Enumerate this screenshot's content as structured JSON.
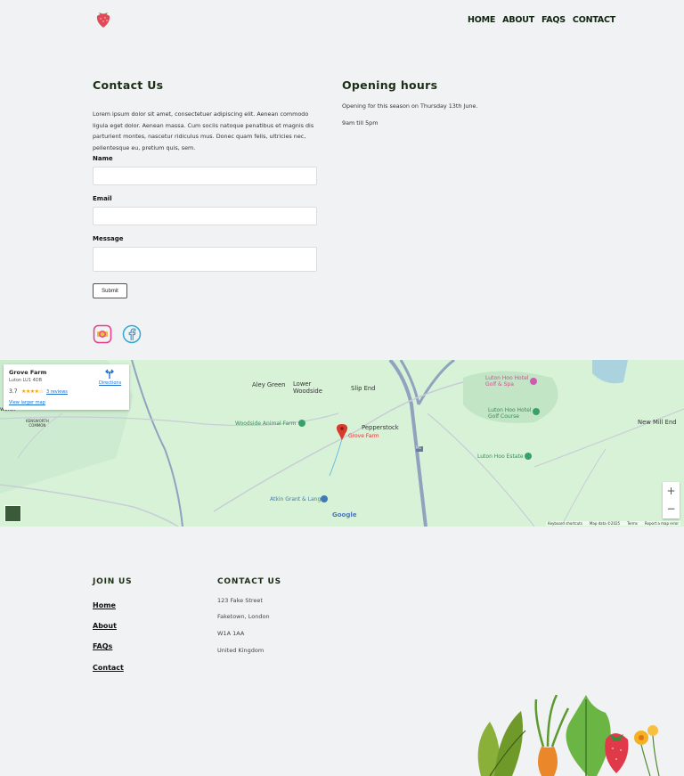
{
  "nav": {
    "items": [
      "HOME",
      "ABOUT",
      "FAQS",
      "CONTACT"
    ]
  },
  "contact": {
    "heading": "Contact Us",
    "intro": "Lorem ipsum dolor sit amet, consectetuer adipiscing elit. Aenean commodo ligula eget dolor. Aenean massa. Cum sociis natoque penatibus et magnis dis parturient montes, nascetur ridiculus mus. Donec quam felis, ultricies nec, pellentesque eu, pretium quis, sem.",
    "name_label": "Name",
    "email_label": "Email",
    "message_label": "Message",
    "name_value": "",
    "email_value": "",
    "message_value": "",
    "submit_label": "Submit"
  },
  "hours": {
    "heading": "Opening hours",
    "line1": "Opening for this season on Thursday 13th June.",
    "line2": "9am till 5pm"
  },
  "social": {
    "icons": [
      "instagram-icon",
      "facebook-icon"
    ]
  },
  "map": {
    "place_name": "Grove Farm",
    "place_address": "Luton LU1 4DB",
    "rating": "3.7",
    "stars": "★★★★☆",
    "reviews": "3 reviews",
    "view_larger": "View larger map",
    "directions": "Directions",
    "labels": {
      "aley_green": "Aley Green",
      "lower_woodside": "Lower\nWoodside",
      "slip_end": "Slip End",
      "pepperstock": "Pepperstock",
      "grove_farm": "Grove Farm",
      "woodside_animal_farm": "Woodside Animal Farm",
      "luton_hoo_hotel_spa": "Luton Hoo Hotel\nGolf & Spa",
      "luton_hoo_golf": "Luton Hoo Hotel\nGolf Course",
      "luton_hoo_estate": "Luton Hoo Estate",
      "new_mill_end": "New Mill End",
      "kensworth_common": "KENSWORTH\nCOMMON",
      "kensworth": "worth",
      "atkin_grant": "Atkin Grant & Lang",
      "google": "Google",
      "m1": "M1"
    },
    "zoom_in": "+",
    "zoom_out": "−",
    "attribution": {
      "shortcuts": "Keyboard shortcuts",
      "data": "Map data ©2025",
      "terms": "Terms",
      "report": "Report a map error"
    },
    "colors": {
      "land": "#d8f2d8",
      "road": "#8fa3bf",
      "pin": "#d93a2f"
    }
  },
  "footer": {
    "join_heading": "JOIN US",
    "links": [
      "Home",
      "About",
      "FAQs",
      "Contact"
    ],
    "contact_heading": "CONTACT US",
    "address": [
      "123 Fake Street",
      "Faketown, London",
      "W1A 1AA",
      "United Kingdom"
    ]
  }
}
